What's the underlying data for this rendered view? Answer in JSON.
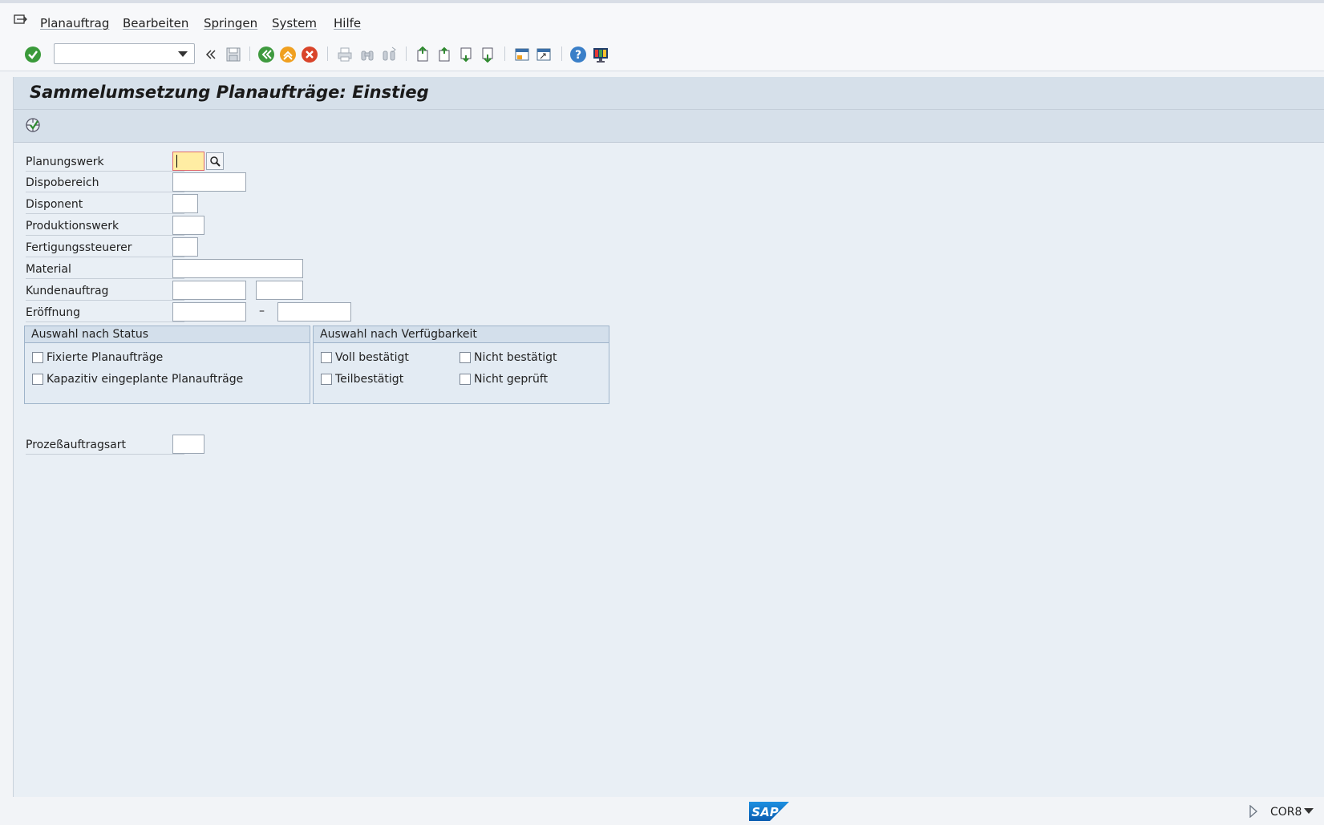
{
  "menu": {
    "items": [
      "Planauftrag",
      "Bearbeiten",
      "Springen",
      "System",
      "Hilfe"
    ]
  },
  "toolbar": {
    "command_field_value": "",
    "icons": [
      "enter-check-icon",
      "command-dropdown-icon",
      "double-chevron-left-icon",
      "save-icon",
      "back-icon",
      "exit-icon",
      "cancel-icon",
      "print-icon",
      "find-icon",
      "find-next-icon",
      "first-page-icon",
      "previous-page-icon",
      "next-page-icon",
      "last-page-icon",
      "new-session-icon",
      "create-shortcut-icon",
      "help-icon",
      "customize-layout-icon"
    ]
  },
  "screen": {
    "title": "Sammelumsetzung Planaufträge: Einstieg",
    "app_toolbar_icon": "execute-icon"
  },
  "form": {
    "planungswerk": {
      "label": "Planungswerk",
      "value": ""
    },
    "dispobereich": {
      "label": "Dispobereich",
      "value": ""
    },
    "disponent": {
      "label": "Disponent",
      "value": ""
    },
    "produktionswerk": {
      "label": "Produktionswerk",
      "value": ""
    },
    "fertigungssteuerer": {
      "label": "Fertigungssteuerer",
      "value": ""
    },
    "material": {
      "label": "Material",
      "value": ""
    },
    "kundenauftrag": {
      "label": "Kundenauftrag",
      "value": "",
      "value2": ""
    },
    "eroeffnung": {
      "label": "Eröffnung",
      "from": "",
      "separator": "–",
      "to": ""
    },
    "prozessauftragsart": {
      "label": "Prozeßauftragsart",
      "value": ""
    }
  },
  "groups": {
    "status": {
      "title": "Auswahl nach Status",
      "options": [
        {
          "label": "Fixierte Planaufträge",
          "checked": false
        },
        {
          "label": "Kapazitiv eingeplante Planaufträge",
          "checked": false
        }
      ]
    },
    "verfuegbarkeit": {
      "title": "Auswahl nach Verfügbarkeit",
      "options": [
        {
          "label": "Voll bestätigt",
          "checked": false
        },
        {
          "label": "Nicht bestätigt",
          "checked": false
        },
        {
          "label": "Teilbestätigt",
          "checked": false
        },
        {
          "label": "Nicht geprüft",
          "checked": false
        }
      ]
    }
  },
  "status_bar": {
    "logo_text": "SAP",
    "system": "COR8"
  }
}
